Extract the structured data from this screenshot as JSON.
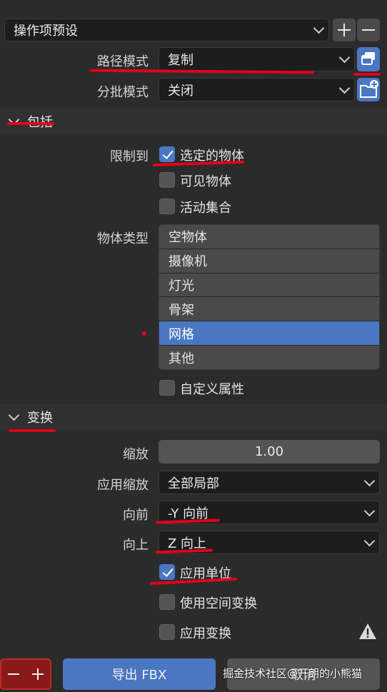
{
  "preset": {
    "label": "操作项预设"
  },
  "path": {
    "label": "路径模式",
    "value": "复制",
    "batch_label": "分批模式",
    "batch_value": "关闭"
  },
  "include": {
    "title": "包括",
    "limit_label": "限制到",
    "selected_objects": "选定的物体",
    "visible_objects": "可见物体",
    "active_collection": "活动集合",
    "object_types_label": "物体类型",
    "object_types": [
      "空物体",
      "摄像机",
      "灯光",
      "骨架",
      "网格",
      "其他"
    ],
    "selected_type": "网格",
    "custom_props": "自定义属性"
  },
  "transform": {
    "title": "变换",
    "scale_label": "缩放",
    "scale_value": "1.00",
    "apply_scale_label": "应用缩放",
    "apply_scale_value": "全部局部",
    "forward_label": "向前",
    "forward_value": "-Y 向前",
    "up_label": "向上",
    "up_value": "Z 向上",
    "apply_unit": "应用单位",
    "use_space_transform": "使用空间变换",
    "apply_transform": "应用变换"
  },
  "checkbox_states": {
    "selected_objects": true,
    "visible_objects": false,
    "active_collection": false,
    "custom_props": false,
    "apply_unit": true,
    "use_space_transform": false,
    "apply_transform": false
  },
  "footer": {
    "export_label": "导出 FBX",
    "cancel_label": "取消",
    "watermark": "掘金技术社区@开朗的小熊猫"
  },
  "colors": {
    "accent": "#4a77c2",
    "annotation": "#e2001a",
    "background": "#2b2b2b"
  }
}
